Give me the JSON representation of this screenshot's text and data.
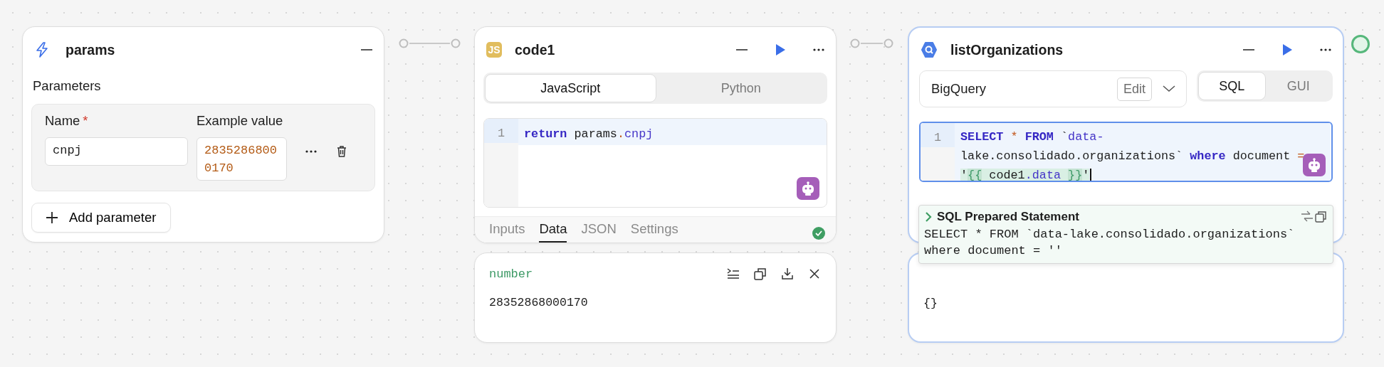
{
  "params_node": {
    "title": "params",
    "section_label": "Parameters",
    "name_header": "Name",
    "required_mark": "*",
    "value_header": "Example value",
    "parameters": [
      {
        "name": "cnpj",
        "example_value": "28352868000170"
      }
    ],
    "add_button": "Add parameter"
  },
  "code_node": {
    "badge": "JS",
    "title": "code1",
    "languages": [
      {
        "label": "JavaScript",
        "selected": true
      },
      {
        "label": "Python",
        "selected": false
      }
    ],
    "line_numbers": [
      "1"
    ],
    "code_tokens": [
      {
        "text": "return",
        "kind": "keyword"
      },
      {
        "text": " params",
        "kind": "plain"
      },
      {
        "text": ".",
        "kind": "operator"
      },
      {
        "text": "cnpj",
        "kind": "property"
      }
    ],
    "tabs": [
      {
        "label": "Inputs",
        "selected": false
      },
      {
        "label": "Data",
        "selected": true
      },
      {
        "label": "JSON",
        "selected": false
      },
      {
        "label": "Settings",
        "selected": false
      }
    ],
    "run_succeeded": true
  },
  "code_output": {
    "type_label": "number",
    "value": "28352868000170"
  },
  "query_node": {
    "title": "listOrganizations",
    "resource": "BigQuery",
    "edit_button": "Edit",
    "modes": [
      {
        "label": "SQL",
        "selected": true
      },
      {
        "label": "GUI",
        "selected": false
      }
    ],
    "line_numbers": [
      "1"
    ],
    "code_tokens": [
      {
        "text": "SELECT",
        "kind": "keyword"
      },
      {
        "text": " * ",
        "kind": "operator"
      },
      {
        "text": "FROM",
        "kind": "keyword"
      },
      {
        "text": " `",
        "kind": "plain"
      },
      {
        "text": "data-",
        "kind": "property"
      },
      {
        "text": "lake.consolidado.organizations` ",
        "kind": "plain"
      },
      {
        "text": "where",
        "kind": "keyword"
      },
      {
        "text": " document ",
        "kind": "plain"
      },
      {
        "text": "= ",
        "kind": "operator"
      },
      {
        "text": "'",
        "kind": "template-plain"
      },
      {
        "text": "{{",
        "kind": "template-brace"
      },
      {
        "text": " code1",
        "kind": "template-plain"
      },
      {
        "text": ".data ",
        "kind": "template-property"
      },
      {
        "text": "}}",
        "kind": "template-brace"
      },
      {
        "text": "'",
        "kind": "template-plain"
      }
    ],
    "prepared_statement": {
      "title": "SQL Prepared Statement",
      "text": "SELECT * FROM `data-lake.consolidado.organizations` where document = ''"
    }
  },
  "query_output": {
    "value": "{}"
  }
}
